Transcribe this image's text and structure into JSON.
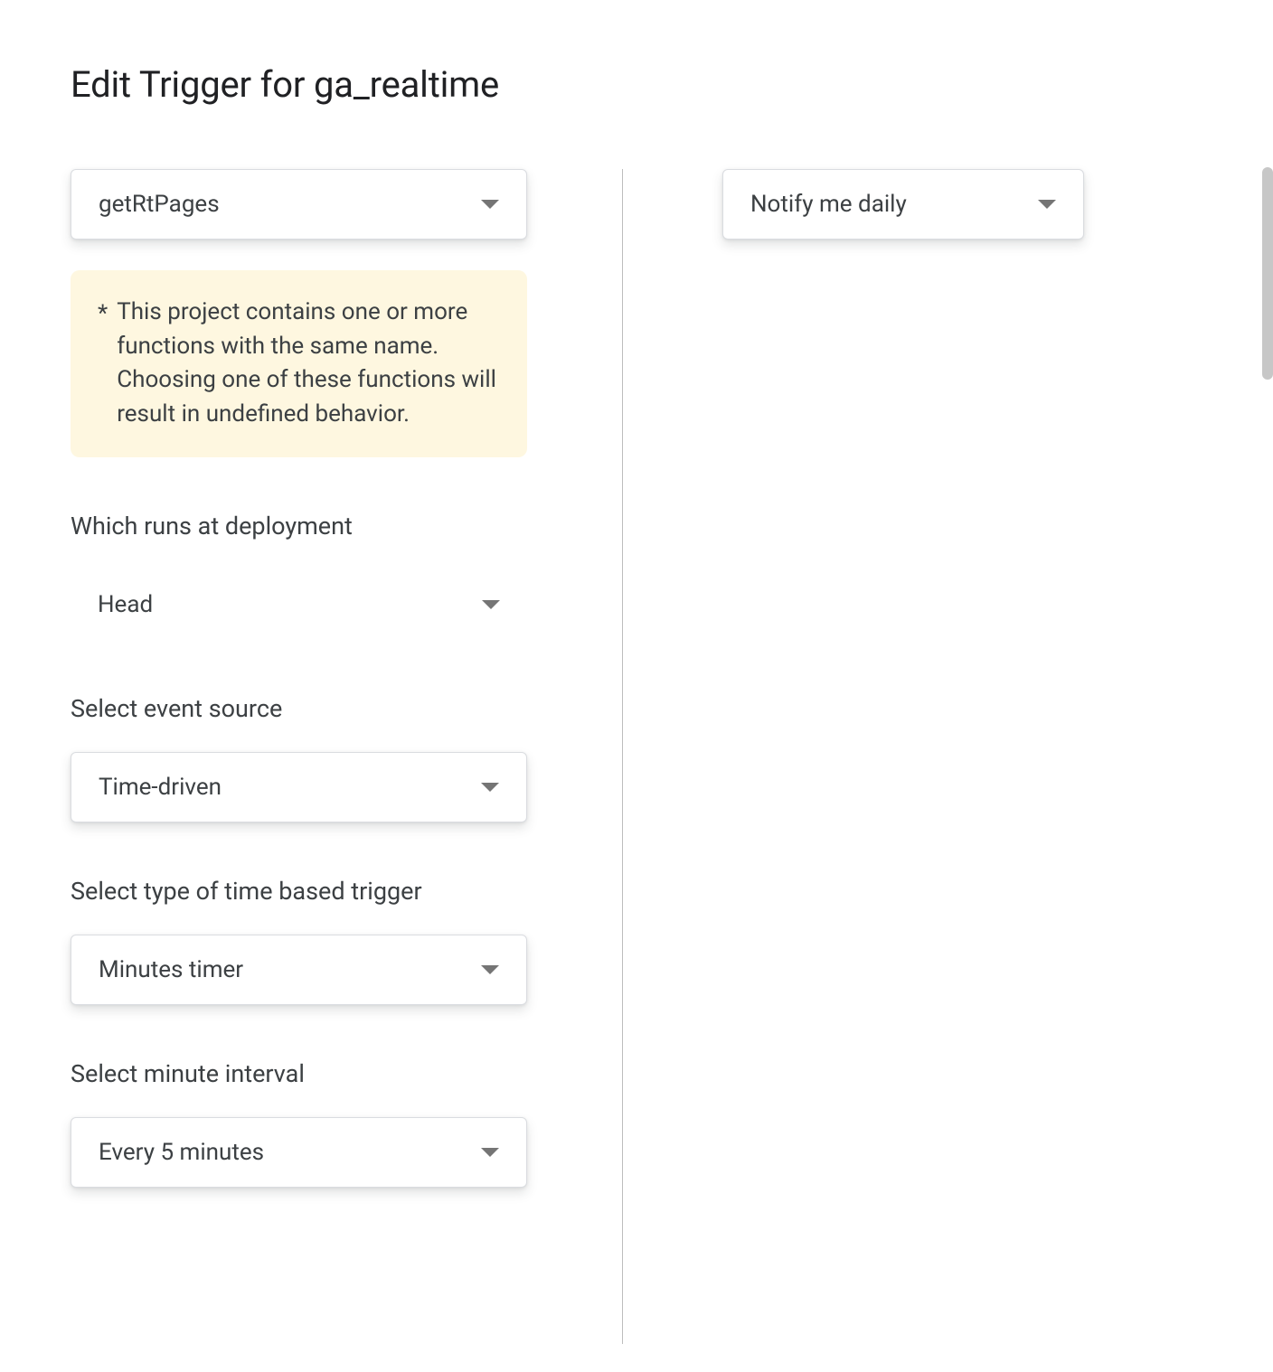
{
  "header": {
    "title": "Edit Trigger for ga_realtime"
  },
  "left": {
    "functionSelect": {
      "value": "getRtPages"
    },
    "warning": {
      "asterisk": "*",
      "text": "This project contains one or more functions with the same name. Choosing one of these functions will result in undefined behavior."
    },
    "deployment": {
      "label": "Which runs at deployment",
      "value": "Head"
    },
    "eventSource": {
      "label": "Select event source",
      "value": "Time-driven"
    },
    "timeTriggerType": {
      "label": "Select type of time based trigger",
      "value": "Minutes timer"
    },
    "minuteInterval": {
      "label": "Select minute interval",
      "value": "Every 5 minutes"
    }
  },
  "right": {
    "notify": {
      "value": "Notify me daily"
    }
  }
}
